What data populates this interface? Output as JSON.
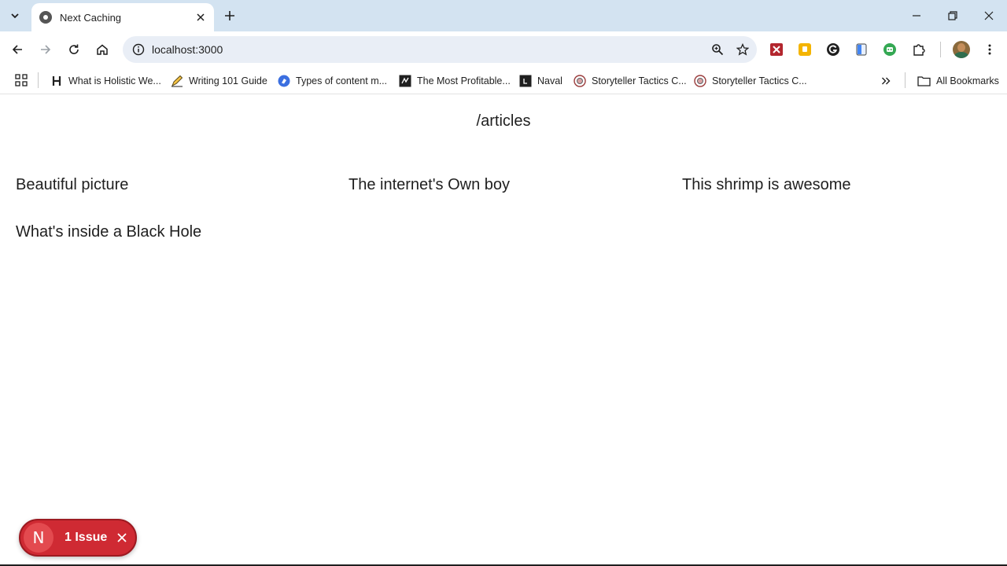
{
  "browser": {
    "tab": {
      "title": "Next Caching"
    },
    "omnibox": {
      "url": "localhost:3000"
    },
    "bookmarks": [
      {
        "label": "What is Holistic We...",
        "icon": "letter-h-icon"
      },
      {
        "label": "Writing 101 Guide",
        "icon": "pen-icon"
      },
      {
        "label": "Types of content m...",
        "icon": "blue-circle-icon"
      },
      {
        "label": "The Most Profitable...",
        "icon": "dark-square-icon"
      },
      {
        "label": "Naval",
        "icon": "dark-square-icon"
      },
      {
        "label": "Storyteller Tactics C...",
        "icon": "round-logo-icon"
      },
      {
        "label": "Storyteller Tactics C...",
        "icon": "round-logo-icon"
      }
    ],
    "all_bookmarks_label": "All Bookmarks",
    "colors": {
      "tabstrip": "#d3e3f1",
      "omnibox": "#e9eef6"
    }
  },
  "page": {
    "heading": "/articles",
    "articles": [
      "Beautiful picture",
      "The internet's Own boy",
      "This shrimp is awesome",
      "What's inside a Black Hole"
    ]
  },
  "issue_badge": {
    "logo_letter": "N",
    "text": "1 Issue",
    "color": "#cf2a33"
  }
}
